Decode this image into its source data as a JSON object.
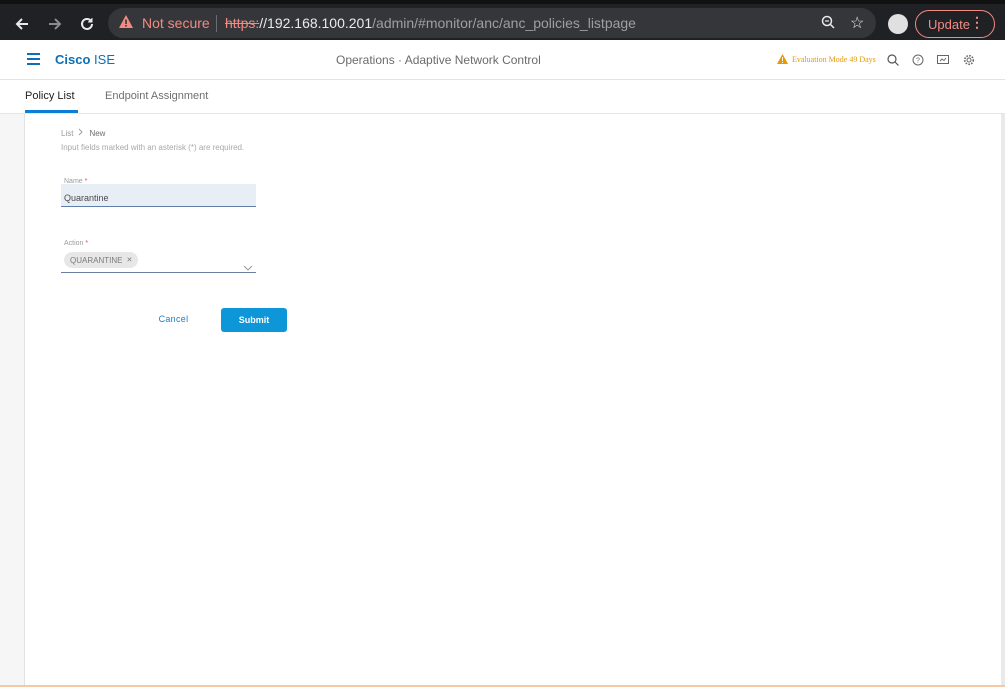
{
  "browser": {
    "security_label": "Not secure",
    "url_scheme": "https:",
    "url_host": "//192.168.100.201",
    "url_path": "/admin/#monitor/anc/anc_policies_listpage",
    "update_label": "Update"
  },
  "app": {
    "brand_bold": "Cisco",
    "brand_light": "ISE",
    "page_title": "Operations · Adaptive Network Control",
    "evaluation_notice": "Evaluation Mode 49 Days"
  },
  "tabs": [
    {
      "label": "Policy List",
      "active": true
    },
    {
      "label": "Endpoint Assignment",
      "active": false
    }
  ],
  "breadcrumb": {
    "parent": "List",
    "current": "New"
  },
  "form": {
    "required_hint": "Input fields marked with an asterisk (*) are required.",
    "name_label": "Name",
    "name_value": "Quarantine",
    "action_label": "Action",
    "action_selected": "QUARANTINE",
    "required_marker": "*"
  },
  "buttons": {
    "cancel": "Cancel",
    "submit": "Submit"
  },
  "colors": {
    "accent": "#0d96d8",
    "brand": "#0d6fb5",
    "warning": "#e69a00",
    "not_secure": "#f28b82"
  }
}
